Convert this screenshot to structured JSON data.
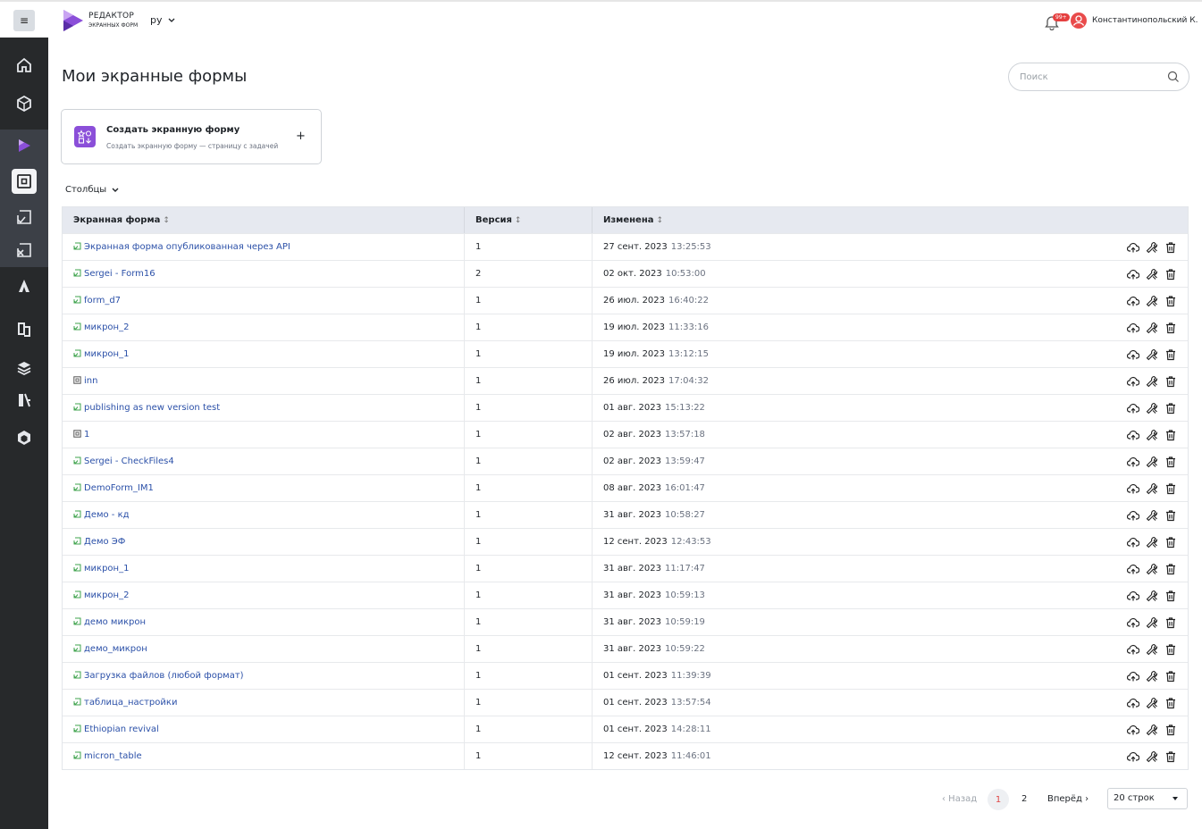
{
  "app": {
    "logo_line1": "РЕДАКТОР",
    "logo_line2": "ЭКРАННЫХ ФОРМ",
    "language": "ру",
    "notifications_badge": "99+",
    "user_name": "Константинопольский К.",
    "brand_color": "#8b4fd9",
    "accent_red": "#e54040"
  },
  "page": {
    "title": "Мои экранные формы",
    "search_placeholder": "Поиск"
  },
  "create_card": {
    "title": "Создать экранную форму",
    "subtitle": "Создать экранную форму — страницу с задачей",
    "plus": "+"
  },
  "columns_toggle": "Столбцы",
  "table": {
    "headers": [
      "Экранная форма",
      "Версия",
      "Изменена"
    ],
    "rows": [
      {
        "name": "Экранная форма опубликованная через API",
        "version": "1",
        "date": "27 сент. 2023",
        "time": "13:25:53",
        "icon": "published-icon"
      },
      {
        "name": "Sergei - Form16",
        "version": "2",
        "date": "02 окт. 2023",
        "time": "10:53:00",
        "icon": "published-icon"
      },
      {
        "name": "form_d7",
        "version": "1",
        "date": "26 июл. 2023",
        "time": "16:40:22",
        "icon": "published-icon"
      },
      {
        "name": "микрон_2",
        "version": "1",
        "date": "19 июл. 2023",
        "time": "11:33:16",
        "icon": "published-icon"
      },
      {
        "name": "микрон_1",
        "version": "1",
        "date": "19 июл. 2023",
        "time": "13:12:15",
        "icon": "published-icon"
      },
      {
        "name": "inn",
        "version": "1",
        "date": "26 июл. 2023",
        "time": "17:04:32",
        "icon": "draft-icon"
      },
      {
        "name": "publishing as new version test",
        "version": "1",
        "date": "01 авг. 2023",
        "time": "15:13:22",
        "icon": "published-icon"
      },
      {
        "name": "1",
        "version": "1",
        "date": "02 авг. 2023",
        "time": "13:57:18",
        "icon": "draft-icon"
      },
      {
        "name": "Sergei - CheckFiles4",
        "version": "1",
        "date": "02 авг. 2023",
        "time": "13:59:47",
        "icon": "published-icon"
      },
      {
        "name": "DemoForm_IM1",
        "version": "1",
        "date": "08 авг. 2023",
        "time": "16:01:47",
        "icon": "published-icon"
      },
      {
        "name": "Демо - кд",
        "version": "1",
        "date": "31 авг. 2023",
        "time": "10:58:27",
        "icon": "published-icon"
      },
      {
        "name": "Демо ЭФ",
        "version": "1",
        "date": "12 сент. 2023",
        "time": "12:43:53",
        "icon": "published-icon"
      },
      {
        "name": "микрон_1",
        "version": "1",
        "date": "31 авг. 2023",
        "time": "11:17:47",
        "icon": "published-icon"
      },
      {
        "name": "микрон_2",
        "version": "1",
        "date": "31 авг. 2023",
        "time": "10:59:13",
        "icon": "published-icon"
      },
      {
        "name": "демо микрон",
        "version": "1",
        "date": "31 авг. 2023",
        "time": "10:59:19",
        "icon": "published-icon"
      },
      {
        "name": "демо_микрон",
        "version": "1",
        "date": "31 авг. 2023",
        "time": "10:59:22",
        "icon": "published-icon"
      },
      {
        "name": "Загрузка файлов (любой формат)",
        "version": "1",
        "date": "01 сент. 2023",
        "time": "11:39:39",
        "icon": "published-icon"
      },
      {
        "name": "таблица_настройки",
        "version": "1",
        "date": "01 сент. 2023",
        "time": "13:57:54",
        "icon": "published-icon"
      },
      {
        "name": "Ethiopian revival",
        "version": "1",
        "date": "01 сент. 2023",
        "time": "14:28:11",
        "icon": "published-icon"
      },
      {
        "name": "micron_table",
        "version": "1",
        "date": "12 сент. 2023",
        "time": "11:46:01",
        "icon": "published-icon"
      }
    ],
    "row_actions": [
      "cloud-publish-icon",
      "wrench-icon",
      "trash-icon"
    ]
  },
  "pagination": {
    "prev": "‹ Назад",
    "pages": [
      "1",
      "2"
    ],
    "current": "1",
    "next": "Вперёд ›",
    "rows_per_page": "20 строк"
  },
  "sidebar_icons": [
    "home-icon",
    "blocks-icon",
    "play-icon",
    "screen-form-icon",
    "task-check-icon",
    "task-cancel-icon",
    "a-logo-icon",
    "document-icon",
    "layers-icon",
    "library-icon",
    "cube-icon"
  ]
}
